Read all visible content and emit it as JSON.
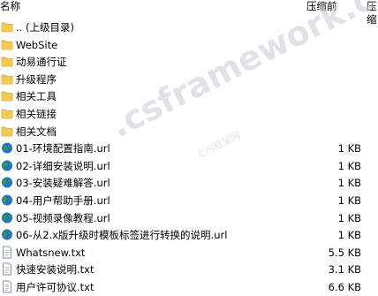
{
  "header": {
    "name": "名称",
    "compressed": "压缩前",
    "original": "压缩"
  },
  "files": [
    {
      "name": ".. (上级目录)",
      "type": "folder",
      "size": ""
    },
    {
      "name": "WebSite",
      "type": "folder",
      "size": ""
    },
    {
      "name": "动易通行证",
      "type": "folder",
      "size": ""
    },
    {
      "name": "升级程序",
      "type": "folder",
      "size": ""
    },
    {
      "name": "相关工具",
      "type": "folder",
      "size": ""
    },
    {
      "name": "相关链接",
      "type": "folder",
      "size": ""
    },
    {
      "name": "相关文档",
      "type": "folder",
      "size": ""
    },
    {
      "name": "01-环境配置指南.url",
      "type": "url",
      "size": "1 KB"
    },
    {
      "name": "02-详细安装说明.url",
      "type": "url",
      "size": "1 KB"
    },
    {
      "name": "03-安装疑难解答.url",
      "type": "url",
      "size": "1 KB"
    },
    {
      "name": "04-用户帮助手册.url",
      "type": "url",
      "size": "1 KB"
    },
    {
      "name": "05-视频录像教程.url",
      "type": "url",
      "size": "1 KB"
    },
    {
      "name": "06-从2.x版升级时模板标签进行转换的说明.url",
      "type": "url",
      "size": "1 KB"
    },
    {
      "name": "Whatsnew.txt",
      "type": "txt",
      "size": "5.5 KB"
    },
    {
      "name": "快速安装说明.txt",
      "type": "txt",
      "size": "3.1 KB"
    },
    {
      "name": "用户许可协议.txt",
      "type": "txt",
      "size": "6.6 KB"
    }
  ],
  "watermark": {
    "main": ".csframework.c",
    "sub": "C/S框架网"
  },
  "colors": {
    "folder": "#f3c94f",
    "folder_edge": "#d9a22b",
    "globe": "#1f74c9",
    "land": "#3a9a3c",
    "doc_edge": "#7d8fa3"
  }
}
